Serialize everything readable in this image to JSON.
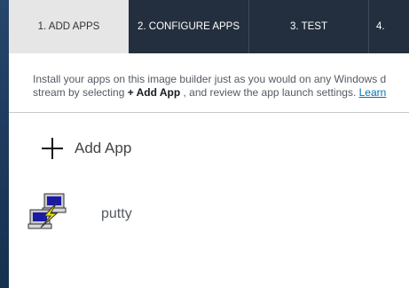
{
  "tabs": [
    {
      "label": "1. ADD APPS",
      "active": true
    },
    {
      "label": "2. CONFIGURE APPS",
      "active": false
    },
    {
      "label": "3. TEST",
      "active": false
    },
    {
      "label": "4.",
      "active": false
    }
  ],
  "description": {
    "line1": "Install your apps on this image builder just as you would on any Windows d",
    "line2_before": "stream by selecting ",
    "line2_bold": "+ Add App",
    "line2_after": " , and review the app launch settings. ",
    "link": "Learn"
  },
  "add_app": {
    "label": "Add App",
    "icon": "plus-icon"
  },
  "apps": [
    {
      "name": "putty",
      "icon": "putty-icon"
    }
  ],
  "colors": {
    "tab_bar": "#232f3e",
    "active_tab": "#e6e6e6",
    "link": "#0073bb",
    "desktop": "#1b3350"
  }
}
